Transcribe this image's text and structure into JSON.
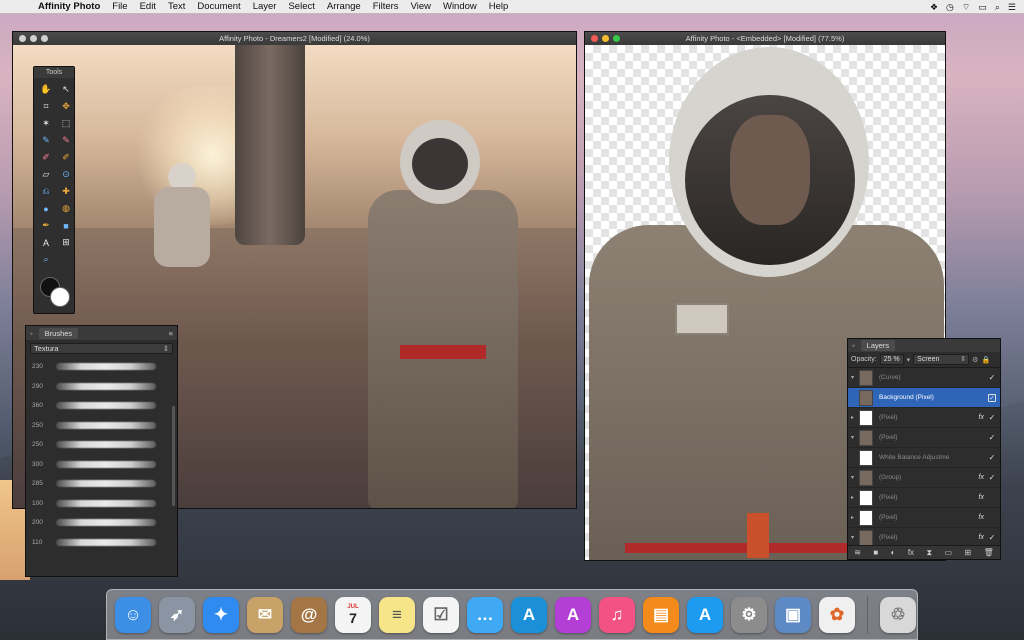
{
  "menubar": {
    "apple": "",
    "app_name": "Affinity Photo",
    "items": [
      "File",
      "Edit",
      "Text",
      "Document",
      "Layer",
      "Select",
      "Arrange",
      "Filters",
      "View",
      "Window",
      "Help"
    ]
  },
  "window_main": {
    "title": "Affinity Photo - Dreamers2 [Modified] (24.0%)"
  },
  "window_embedded": {
    "title": "Affinity Photo - <Embedded> [Modified] (77.5%)"
  },
  "tools_panel": {
    "title": "Tools",
    "icons": [
      "hand-icon",
      "pointer-icon",
      "crop-icon",
      "move-selection-icon",
      "magic-wand-icon",
      "marquee-icon",
      "paint-brush-icon",
      "color-brush-icon",
      "fill-icon",
      "mixer-brush-icon",
      "erase-icon",
      "smudge-icon",
      "clone-icon",
      "healing-icon",
      "dodge-icon",
      "sponge-icon",
      "dropper-icon",
      "blur-icon",
      "pen-icon",
      "shape-icon",
      "text-icon",
      "frame-text-icon",
      "zoom-icon"
    ]
  },
  "brushes_panel": {
    "tab": "Brushes",
    "category": "Textura",
    "brush_sizes": [
      "230",
      "290",
      "360",
      "250",
      "250",
      "300",
      "285",
      "100",
      "200",
      "110"
    ]
  },
  "layers_panel": {
    "tab": "Layers",
    "opacity_label": "Opacity:",
    "opacity_value": "25 %",
    "blend_mode": "Screen",
    "layers": [
      {
        "name": "(Curve)",
        "selected": false,
        "fx": false,
        "visible": true,
        "thumb": "curve"
      },
      {
        "name": "Background (Pixel)",
        "bold": "Background",
        "sub": "(Pixel)",
        "selected": true,
        "fx": false,
        "visible": true,
        "thumb": "photo"
      },
      {
        "name": "(Pixel)",
        "selected": false,
        "fx": true,
        "visible": true,
        "thumb": "mask"
      },
      {
        "name": "(Pixel)",
        "selected": false,
        "fx": false,
        "visible": true,
        "thumb": "photo"
      },
      {
        "name": "White Balance Adjustme",
        "selected": false,
        "fx": false,
        "visible": true,
        "thumb": "white"
      },
      {
        "name": "(Group)",
        "selected": false,
        "fx": true,
        "visible": true,
        "thumb": "photo"
      },
      {
        "name": "(Pixel)",
        "selected": false,
        "fx": true,
        "visible": false,
        "thumb": "mask"
      },
      {
        "name": "(Pixel)",
        "selected": false,
        "fx": true,
        "visible": false,
        "thumb": "mask"
      },
      {
        "name": "(Pixel)",
        "selected": false,
        "fx": true,
        "visible": true,
        "thumb": "photo"
      }
    ]
  },
  "dock": {
    "items": [
      {
        "name": "finder",
        "glyph": "☺",
        "color": "#3d8fe6"
      },
      {
        "name": "launchpad",
        "glyph": "🚀",
        "color": "#8a94a3"
      },
      {
        "name": "safari",
        "glyph": "✦",
        "color": "#2f8bf0"
      },
      {
        "name": "mail",
        "glyph": "✉",
        "color": "#c7a36a"
      },
      {
        "name": "contacts",
        "glyph": "@",
        "color": "#a57645"
      },
      {
        "name": "calendar",
        "glyph": "7",
        "label": "JUL",
        "color": "#f4f4f4"
      },
      {
        "name": "notes",
        "glyph": "≡",
        "color": "#f7e58a"
      },
      {
        "name": "reminders",
        "glyph": "☑",
        "color": "#f4f4f4"
      },
      {
        "name": "messages",
        "glyph": "…",
        "color": "#3fa9f5"
      },
      {
        "name": "affinity-designer",
        "glyph": "A",
        "color": "#1b8fd8"
      },
      {
        "name": "affinity-photo",
        "glyph": "A",
        "color": "#b43fd6"
      },
      {
        "name": "itunes",
        "glyph": "♫",
        "color": "#f25384"
      },
      {
        "name": "ibooks",
        "glyph": "📖",
        "color": "#f28b1b"
      },
      {
        "name": "app-store",
        "glyph": "A",
        "color": "#1d9bf0"
      },
      {
        "name": "system-preferences",
        "glyph": "⚙",
        "color": "#8c8c8c"
      },
      {
        "name": "preview",
        "glyph": "▣",
        "color": "#5d89c4"
      },
      {
        "name": "photos",
        "glyph": "✿",
        "color": "#f0f0f0"
      },
      {
        "name": "trash",
        "glyph": "🗑",
        "color": "#d8d8d8"
      }
    ]
  }
}
